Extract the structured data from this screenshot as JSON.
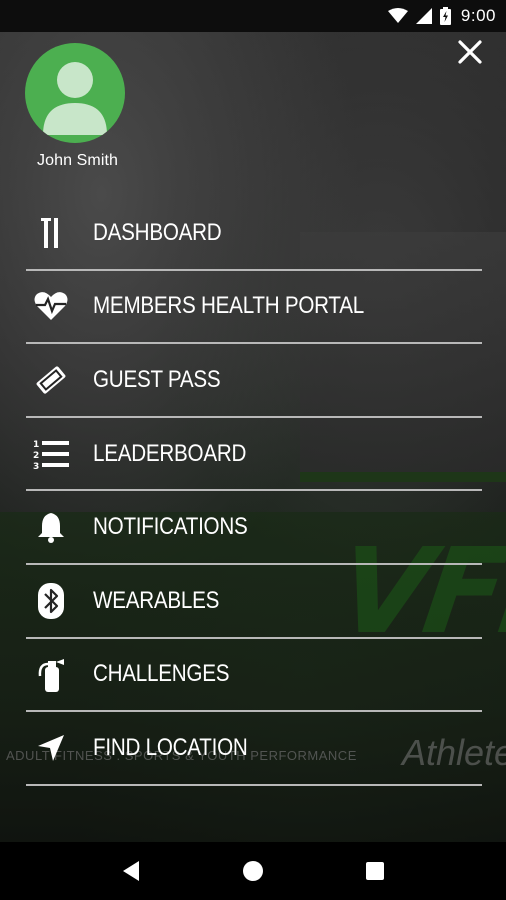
{
  "status_bar": {
    "time": "9:00",
    "icons": [
      "wifi-icon",
      "signal-icon",
      "battery-icon"
    ]
  },
  "drawer": {
    "close_icon": "close-icon",
    "user": {
      "name": "John Smith",
      "avatar_icon": "person-icon",
      "avatar_color": "#4caf50"
    },
    "menu": [
      {
        "label": "DASHBOARD",
        "icon": "dashboard-icon"
      },
      {
        "label": "MEMBERS HEALTH PORTAL",
        "icon": "heart-pulse-icon"
      },
      {
        "label": "GUEST PASS",
        "icon": "ticket-icon"
      },
      {
        "label": "LEADERBOARD",
        "icon": "numbered-list-icon"
      },
      {
        "label": "NOTIFICATIONS",
        "icon": "bell-icon"
      },
      {
        "label": "WEARABLES",
        "icon": "bluetooth-icon"
      },
      {
        "label": "CHALLENGES",
        "icon": "fire-extinguisher-icon"
      },
      {
        "label": "FIND LOCATION",
        "icon": "navigation-arrow-icon"
      }
    ]
  },
  "background": {
    "brand": "VFit",
    "brand_sub": "Athlete",
    "tagline": "ADULT FITNESS . SPORTS & YOUTH PERFORMANCE"
  },
  "nav_bar": {
    "icons": [
      "back-icon",
      "home-icon",
      "recents-icon"
    ]
  },
  "colors": {
    "accent": "#4caf50",
    "divider": "#b8b8b8",
    "text": "#ffffff"
  }
}
